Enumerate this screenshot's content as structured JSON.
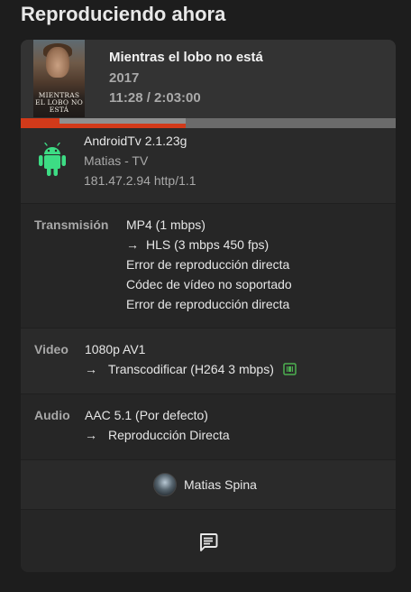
{
  "page": {
    "title": "Reproduciendo ahora"
  },
  "movie": {
    "title": "Mientras el lobo no está",
    "year": "2017",
    "time": "11:28 / 2:03:00",
    "poster_title_line1": "MIENTRAS",
    "poster_title_line2": "EL LOBO NO ESTÁ"
  },
  "progress": {
    "played_fraction": 0.093,
    "buffered_fraction": 0.44
  },
  "device": {
    "icon": "android-icon",
    "client": "AndroidTv 2.1.23g",
    "name": "Matias - TV",
    "address": "181.47.2.94 http/1.1"
  },
  "stream": {
    "label": "Transmisión",
    "container": "MP4 (1 mbps)",
    "arrow": "→",
    "target": "HLS (3 mbps 450 fps)",
    "reason1": "Error de reproducción directa",
    "reason2": "Códec de vídeo no soportado",
    "reason3": "Error de reproducción directa"
  },
  "video": {
    "label": "Video",
    "source": "1080p AV1",
    "arrow": "→",
    "target": "Transcodificar (H264 3 mbps)",
    "hw_icon": "hardware-accel-icon"
  },
  "audio": {
    "label": "Audio",
    "source": "AAC 5.1 (Por defecto)",
    "arrow": "→",
    "target": "Reproducción Directa"
  },
  "user": {
    "name": "Matias Spina"
  },
  "actions": {
    "message_icon": "message-icon"
  },
  "colors": {
    "accent": "#d23a1a",
    "android_green": "#3ddc84",
    "hw_green": "#4caf50",
    "card_bg": "#262626",
    "page_bg": "#1d1d1d"
  }
}
